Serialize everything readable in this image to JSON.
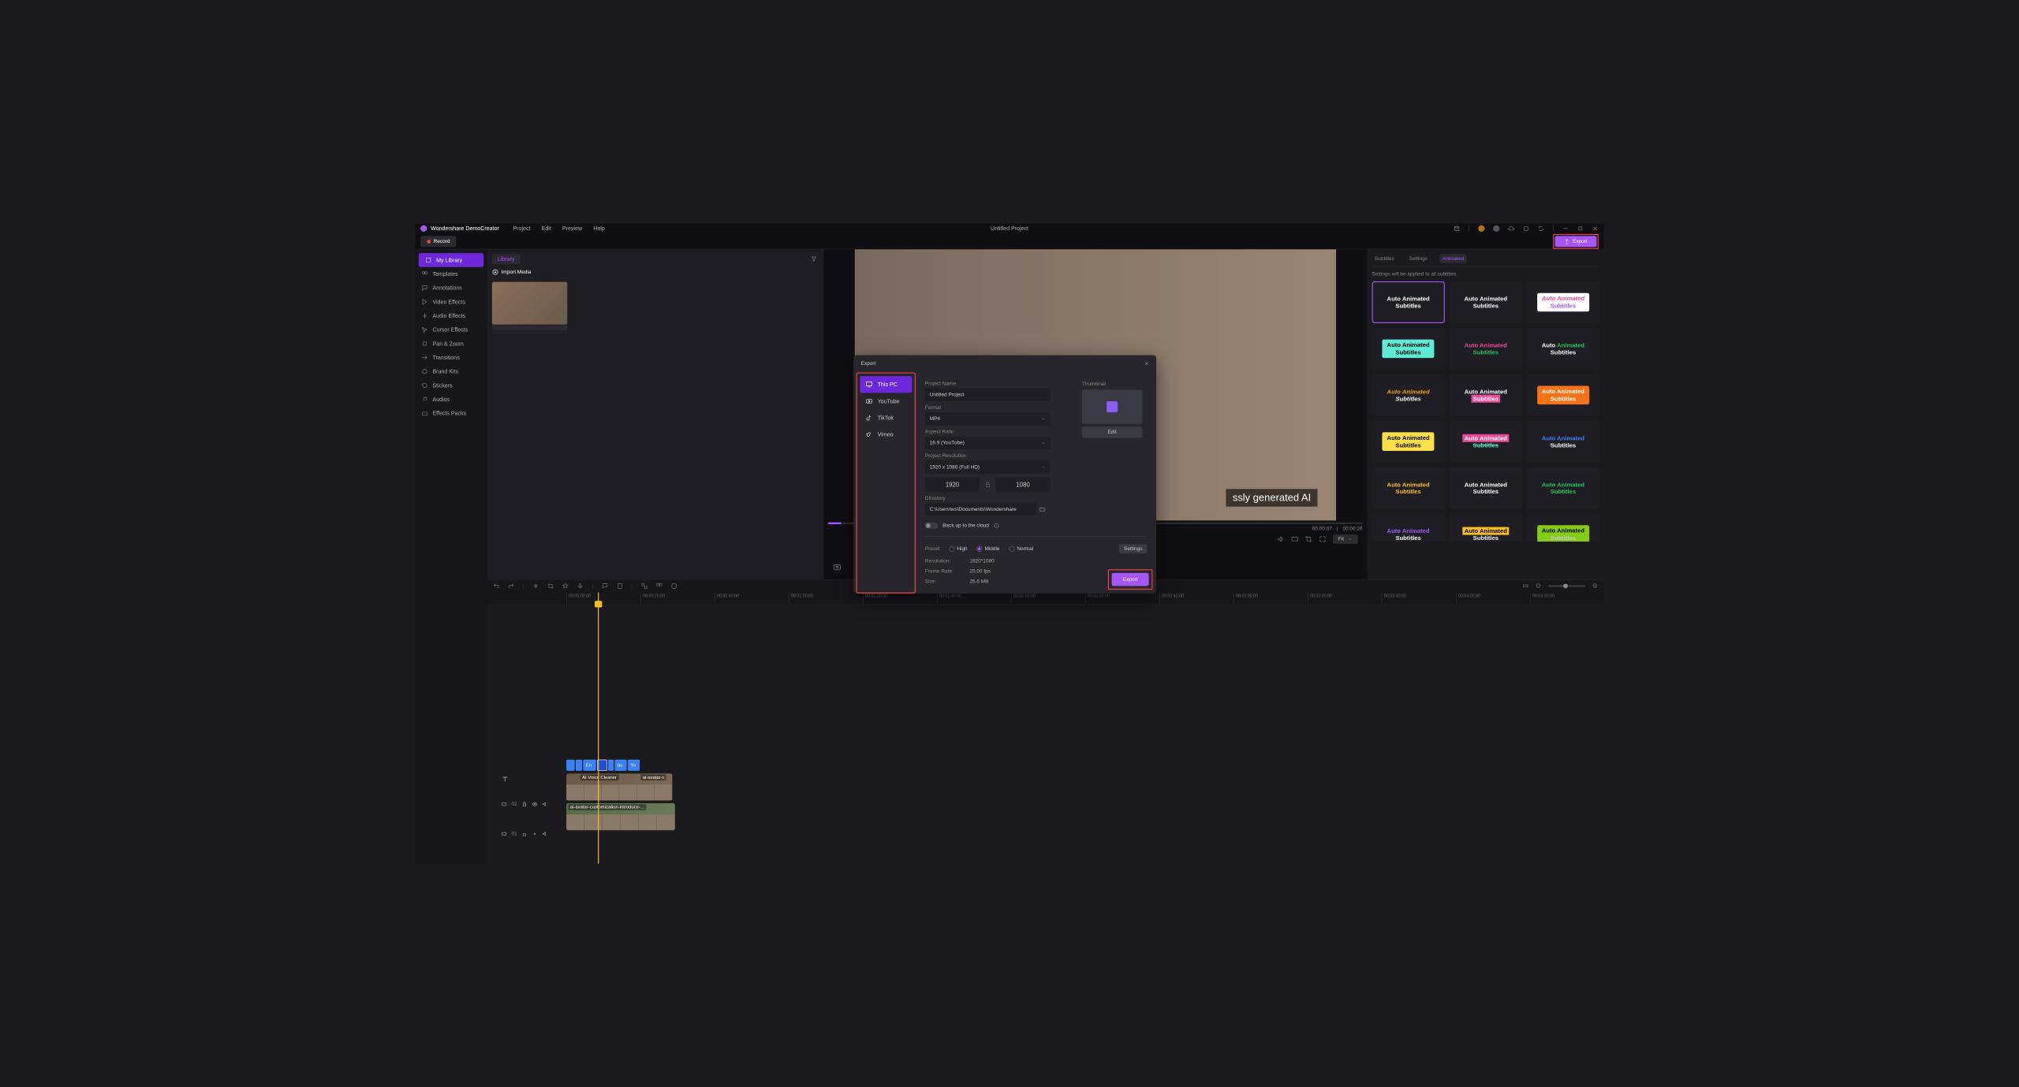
{
  "app": {
    "name": "Wondershare DemoCreator",
    "project_title": "Untitled Project"
  },
  "menu": [
    "Project",
    "Edit",
    "Preview",
    "Help"
  ],
  "record_label": "Record",
  "export_label": "Export",
  "left_nav": [
    {
      "label": "My Library",
      "active": true
    },
    {
      "label": "Templates"
    },
    {
      "label": "Annotations"
    },
    {
      "label": "Video Effects"
    },
    {
      "label": "Audio Effects"
    },
    {
      "label": "Cursor Effects"
    },
    {
      "label": "Pan & Zoom"
    },
    {
      "label": "Transitions"
    },
    {
      "label": "Brand Kits"
    },
    {
      "label": "Stickers"
    },
    {
      "label": "Audios"
    },
    {
      "label": "Effects Packs"
    }
  ],
  "library": {
    "tab": "Library",
    "import": "Import Media"
  },
  "preview": {
    "subtitle_text": "ssly generated AI",
    "time_current": "00:00:07",
    "time_total": "00:00:26",
    "fit": "Fit"
  },
  "right_tabs": [
    "Subtitles",
    "Settings",
    "Animated"
  ],
  "right_note": "Settings will be applied to all subtitles.",
  "style_cards": [
    {
      "l1": "Auto Animated",
      "l2": "Subtitles"
    },
    {
      "l1": "Auto Animated",
      "l2": "Subtitles"
    },
    {
      "l1": "Auto Animated",
      "l2": "Subtitles"
    },
    {
      "l1": "Auto Animated",
      "l2": "Subtitles"
    },
    {
      "l1": "Auto Animated",
      "l2": "Subtitles"
    },
    {
      "l1": "Auto Animated",
      "l2": "Subtitles"
    },
    {
      "l1": "Auto Animated",
      "l2": "Subtitles"
    },
    {
      "l1": "Auto Animated",
      "l2": "Subtitles"
    },
    {
      "l1": "Auto Animated",
      "l2": "Subtitles"
    },
    {
      "l1": "Auto Animated",
      "l2": "Subtitles"
    },
    {
      "l1": "Auto Animated",
      "l2": "Subtitles"
    },
    {
      "l1": "Auto Animated",
      "l2": "Subtitles"
    },
    {
      "l1": "Auto Animated",
      "l2": "Subtitles"
    },
    {
      "l1": "Auto Animated",
      "l2": "Subtitles"
    },
    {
      "l1": "Auto Animated",
      "l2": "Subtitles"
    },
    {
      "l1": "Auto Animated",
      "l2": "Subtitles"
    },
    {
      "l1": "Auto Animated",
      "l2": "Subtitles"
    },
    {
      "l1": "Auto Animated",
      "l2": "Subtitles"
    }
  ],
  "ruler": [
    "00:00:00:00",
    "00:00:20:00",
    "00:00:40:00",
    "00:01:00:00",
    "00:01:20:00",
    "00:01:40:00",
    "00:02:00:00",
    "00:02:20:00",
    "00:02:40:00",
    "00:03:00:00",
    "00:03:20:00",
    "00:03:40:00",
    "00:04:00:00",
    "00:04:20:00"
  ],
  "tracks": {
    "t02": "02",
    "t01": "01",
    "sub_clips": [
      "",
      "",
      "En",
      "",
      "",
      "",
      "bu",
      "Yo"
    ],
    "clip1a": "AI Voice Cleaner",
    "clip1b": "ai-avatar-c",
    "clip2": "ai-avatar-customization-introduce-..."
  },
  "export": {
    "title": "Export",
    "dests": [
      "This PC",
      "YouTube",
      "TikTok",
      "Vimeo"
    ],
    "fields": {
      "project_name_label": "Project Name",
      "project_name": "Untitled Project",
      "format_label": "Format",
      "format": "MP4",
      "aspect_label": "Aspect Ratio",
      "aspect": "16:9 (YouTube)",
      "resolution_label": "Project Resolution",
      "resolution": "1920 x 1080 (Full HD)",
      "width": "1920",
      "height": "1080",
      "directory_label": "Directory",
      "directory": "C:\\Users\\ws\\Documents\\Wondershare",
      "backup": "Back up to the cloud"
    },
    "thumbnail_label": "Thumbnail",
    "edit_label": "Edit",
    "preset_label": "Preset",
    "presets": [
      "High",
      "Middle",
      "Normal"
    ],
    "settings_label": "Settings",
    "info": {
      "resolution_k": "Resolution:",
      "resolution_v": "1920*1080",
      "framerate_k": "Frame Rate:",
      "framerate_v": "25.00 fps",
      "size_k": "Size:",
      "size_v": "25.6 MB"
    },
    "action": "Export"
  }
}
